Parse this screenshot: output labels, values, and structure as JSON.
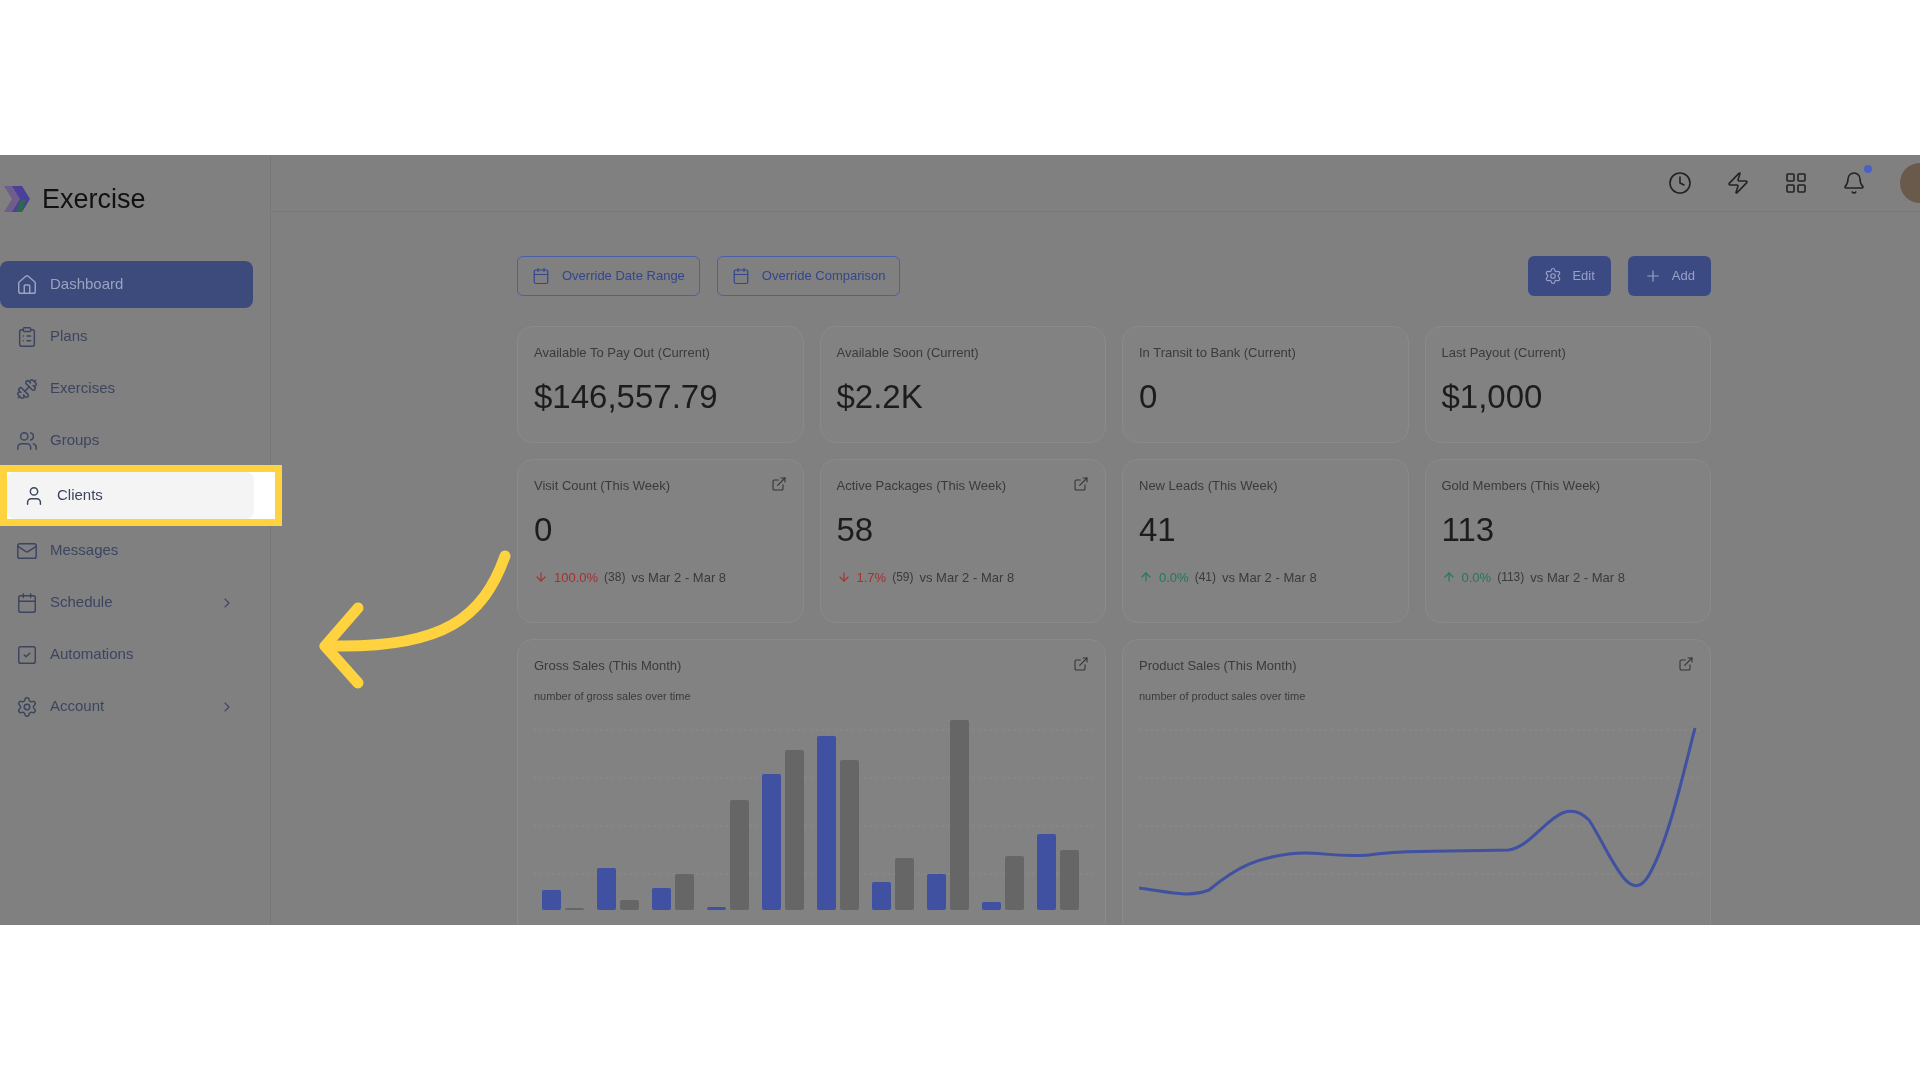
{
  "brand": {
    "name": "Exercise"
  },
  "sidebar": {
    "items": [
      {
        "label": "Dashboard",
        "selected": true,
        "highlighted": false,
        "expandable": false
      },
      {
        "label": "Plans",
        "selected": false,
        "highlighted": false,
        "expandable": false
      },
      {
        "label": "Exercises",
        "selected": false,
        "highlighted": false,
        "expandable": false
      },
      {
        "label": "Groups",
        "selected": false,
        "highlighted": false,
        "expandable": false
      },
      {
        "label": "Clients",
        "selected": false,
        "highlighted": true,
        "expandable": false
      },
      {
        "label": "Messages",
        "selected": false,
        "highlighted": false,
        "expandable": false
      },
      {
        "label": "Schedule",
        "selected": false,
        "highlighted": false,
        "expandable": true
      },
      {
        "label": "Automations",
        "selected": false,
        "highlighted": false,
        "expandable": false
      },
      {
        "label": "Account",
        "selected": false,
        "highlighted": false,
        "expandable": true
      }
    ]
  },
  "topbar": {
    "notification_unread": true
  },
  "toolbar": {
    "filters": [
      "Override Date Range",
      "Override Comparison"
    ],
    "actions": [
      {
        "label": "Edit"
      },
      {
        "label": "Add"
      }
    ]
  },
  "cards": [
    {
      "kind": "stat",
      "title": "Available To Pay Out (Current)",
      "value": "$146,557.79",
      "has_link": false
    },
    {
      "kind": "stat",
      "title": "Available Soon (Current)",
      "value": "$2.2K",
      "has_link": false
    },
    {
      "kind": "stat",
      "title": "In Transit to Bank (Current)",
      "value": "0",
      "has_link": false
    },
    {
      "kind": "stat",
      "title": "Last Payout (Current)",
      "value": "$1,000",
      "has_link": false
    },
    {
      "kind": "decrease",
      "title": "Visit Count (This Week)",
      "value": "0",
      "has_link": true,
      "change": "100.0%",
      "previous": "(38)",
      "comparison": "vs Mar 2 - Mar 8"
    },
    {
      "kind": "decrease",
      "title": "Active Packages (This Week)",
      "value": "58",
      "has_link": true,
      "change": "1.7%",
      "previous": "(59)",
      "comparison": "vs Mar 2 - Mar 8"
    },
    {
      "kind": "increase",
      "title": "New Leads (This Week)",
      "value": "41",
      "has_link": false,
      "change": "0.0%",
      "previous": "(41)",
      "comparison": "vs Mar 2 - Mar 8"
    },
    {
      "kind": "increase",
      "title": "Gold Members (This Week)",
      "value": "113",
      "has_link": false,
      "change": "0.0%",
      "previous": "(113)",
      "comparison": "vs Mar 2 - Mar 8"
    }
  ],
  "charts": [
    {
      "kind": "bars",
      "title": "Gross Sales (This Month)",
      "subtitle": "number of gross sales over time",
      "has_link": true
    },
    {
      "kind": "line",
      "title": "Product Sales (This Month)",
      "subtitle": "number of product sales over time",
      "has_link": true
    }
  ]
}
